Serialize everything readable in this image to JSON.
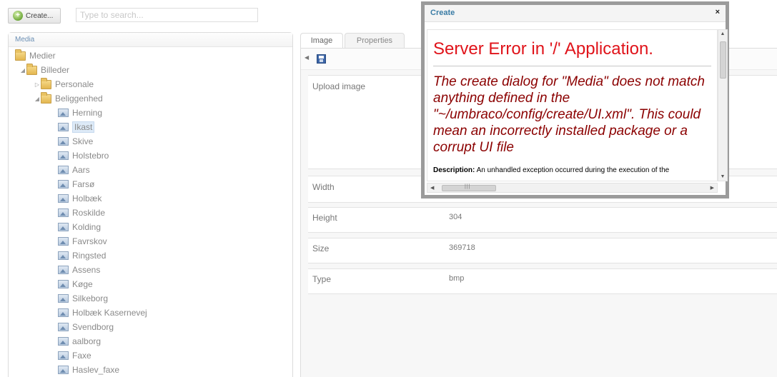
{
  "toolbar": {
    "create_label": "Create...",
    "search_placeholder": "Type to search..."
  },
  "tree": {
    "title": "Media",
    "root": "Medier",
    "folders": [
      "Billeder",
      "Personale",
      "Beliggenhed"
    ],
    "items": [
      "Herning",
      "Ikast",
      "Skive",
      "Holstebro",
      "Aars",
      "Farsø",
      "Holbæk",
      "Roskilde",
      "Kolding",
      "Favrskov",
      "Ringsted",
      "Assens",
      "Køge",
      "Silkeborg",
      "Holbæk Kasernevej",
      "Svendborg",
      "aalborg",
      "Faxe",
      "Haslev_faxe"
    ],
    "selected_item": "Ikast"
  },
  "tabs": [
    "Image",
    "Properties"
  ],
  "properties": [
    {
      "label": "Upload image",
      "value": ""
    },
    {
      "label": "Width",
      "value": ""
    },
    {
      "label": "Height",
      "value": "304"
    },
    {
      "label": "Size",
      "value": "369718"
    },
    {
      "label": "Type",
      "value": "bmp"
    }
  ],
  "dialog": {
    "title": "Create",
    "close_glyph": "×",
    "error_title": "Server Error in '/' Application.",
    "error_message": "The create dialog for \"Media\" does not match anything defined in the \"~/umbraco/config/create/UI.xml\". This could mean an incorrectly installed package or a corrupt UI file",
    "description_label": "Description:",
    "description_text": "An unhandled exception occurred during the execution of the"
  },
  "icons": {
    "create": "add-icon",
    "save": "save-icon",
    "folder": "folder-icon",
    "image": "image-icon"
  }
}
